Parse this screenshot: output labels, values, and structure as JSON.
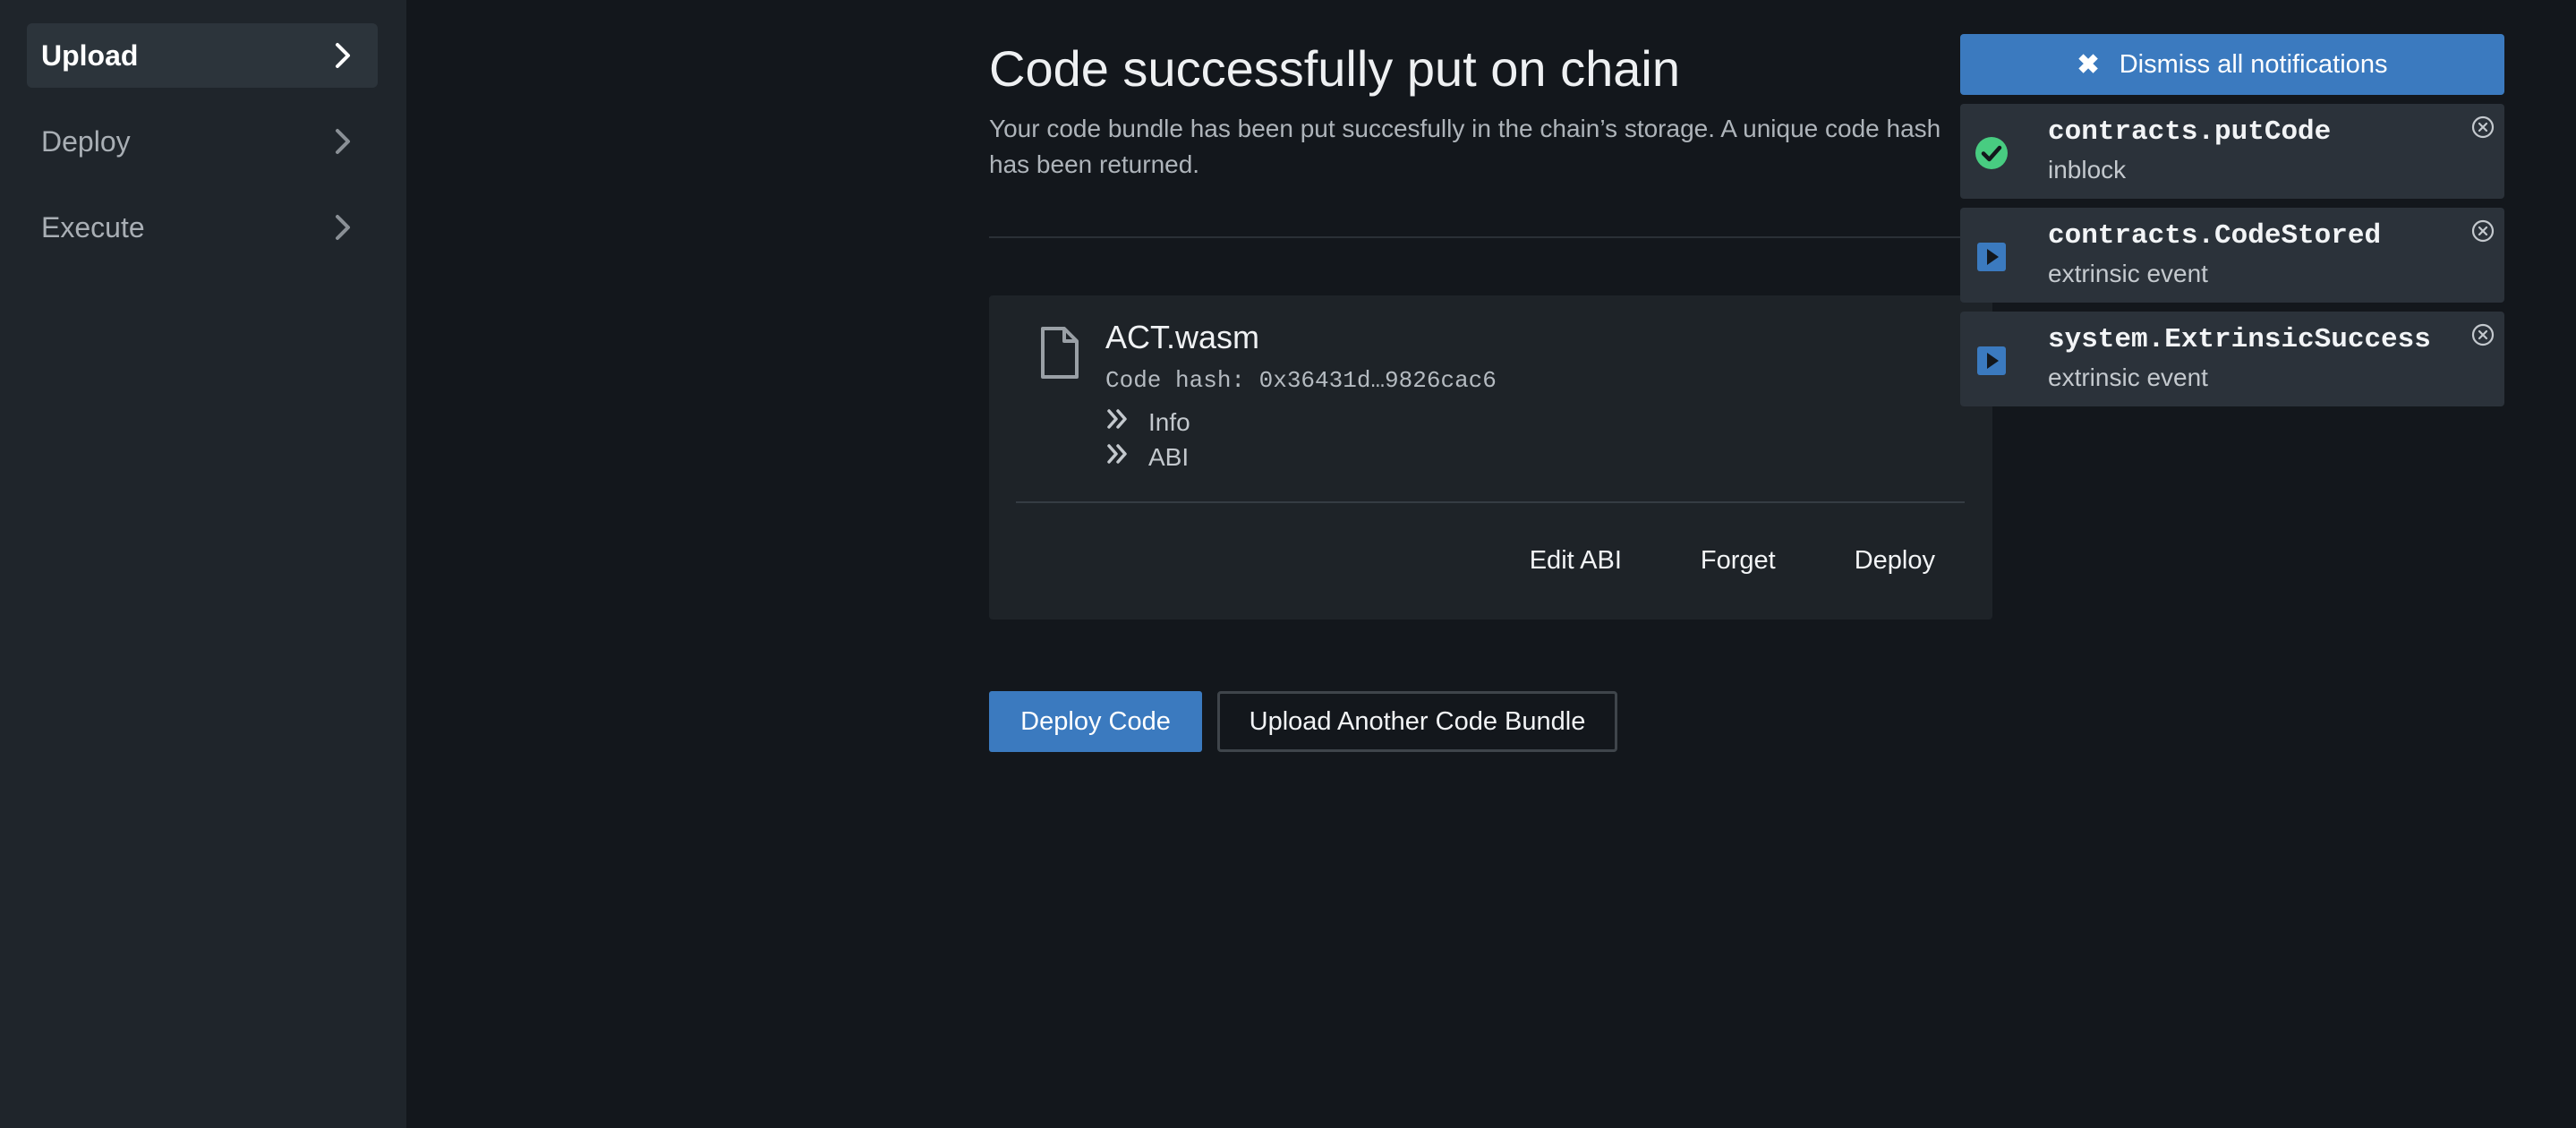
{
  "sidebar": {
    "items": [
      {
        "label": "Upload",
        "active": true,
        "icon": "chevron-right-icon"
      },
      {
        "label": "Deploy",
        "active": false,
        "icon": "chevron-right-icon"
      },
      {
        "label": "Execute",
        "active": false,
        "icon": "chevron-right-icon"
      }
    ]
  },
  "main": {
    "title": "Code successfully put on chain",
    "subtitle": "Your code bundle has been put succesfully in the chain’s storage. A unique code hash has been returned."
  },
  "card": {
    "file_icon": "file-icon",
    "file_name": "ACT.wasm",
    "code_hash": "Code hash: 0x36431d…9826cac6",
    "expanders": [
      {
        "label": "Info",
        "icon": "double-chevron-right-icon"
      },
      {
        "label": "ABI",
        "icon": "double-chevron-right-icon"
      }
    ],
    "actions": {
      "edit_abi": "Edit ABI",
      "forget": "Forget",
      "deploy": "Deploy"
    }
  },
  "buttons": {
    "deploy_code": "Deploy Code",
    "upload_another": "Upload Another Code Bundle"
  },
  "notifications": {
    "dismiss_all": "Dismiss all notifications",
    "items": [
      {
        "title": "contracts.putCode",
        "status": "inblock",
        "icon": "check-circle-icon"
      },
      {
        "title": "contracts.CodeStored",
        "status": "extrinsic event",
        "icon": "play-square-icon"
      },
      {
        "title": "system.ExtrinsicSuccess",
        "status": "extrinsic event",
        "icon": "play-square-icon"
      }
    ]
  },
  "colors": {
    "accent": "#3b7abf",
    "success": "#48cc81",
    "background": "#13171c",
    "sidebar": "#1f252b"
  }
}
